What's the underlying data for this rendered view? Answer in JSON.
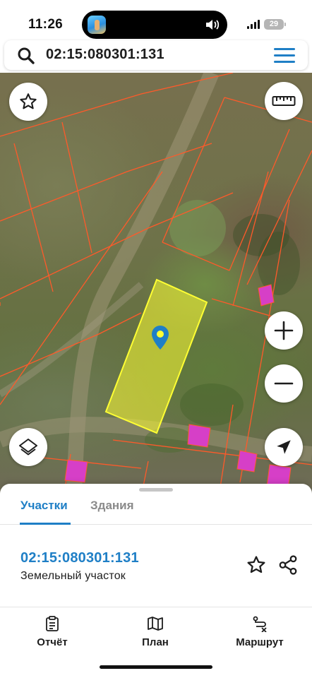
{
  "status_bar": {
    "time": "11:26",
    "battery": "29",
    "signal_bars": 4
  },
  "search": {
    "query": "02:15:080301:131",
    "icon": "search-icon",
    "menu_icon": "hamburger-menu-icon"
  },
  "map": {
    "parcel_fill_color": "#ffff33",
    "boundary_color": "#ff5a2a",
    "building_color": "#d63fc7",
    "buttons": {
      "favorite": "star-icon",
      "ruler": "ruler-icon",
      "zoom_in": "plus-icon",
      "zoom_out": "minus-icon",
      "layers": "layers-icon",
      "locate": "location-arrow-icon"
    }
  },
  "sheet": {
    "tabs": [
      {
        "label": "Участки",
        "active": true
      },
      {
        "label": "Здания",
        "active": false
      }
    ],
    "result": {
      "number": "02:15:080301:131",
      "type": "Земельный участок"
    },
    "nav": [
      {
        "label": "Отчёт",
        "icon": "report-icon"
      },
      {
        "label": "План",
        "icon": "map-plan-icon"
      },
      {
        "label": "Маршрут",
        "icon": "route-icon"
      }
    ]
  },
  "colors": {
    "accent": "#1f7fc6",
    "inactive_text": "#8a8a8a"
  }
}
